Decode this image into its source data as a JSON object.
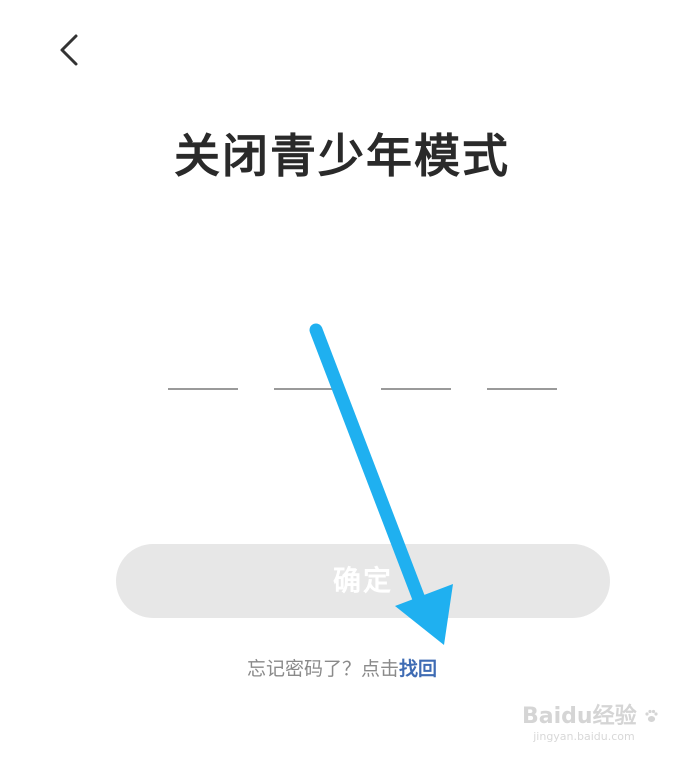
{
  "header": {
    "back_icon": "chevron-left-icon"
  },
  "title": "关闭青少年模式",
  "pin": {
    "length": 4,
    "digits": [
      "",
      "",
      "",
      ""
    ]
  },
  "confirm_label": "确定",
  "forgot": {
    "prefix": "忘记密码了？点击",
    "link": "找回"
  },
  "watermark": {
    "logo_text": "Baidu经验",
    "url": "jingyan.baidu.com"
  },
  "colors": {
    "title": "#2a2a2a",
    "button_bg": "#e7e7e7",
    "link": "#3f6cb4",
    "annotation_arrow": "#1fb0f0",
    "pin_underline": "#9a9a9a"
  }
}
